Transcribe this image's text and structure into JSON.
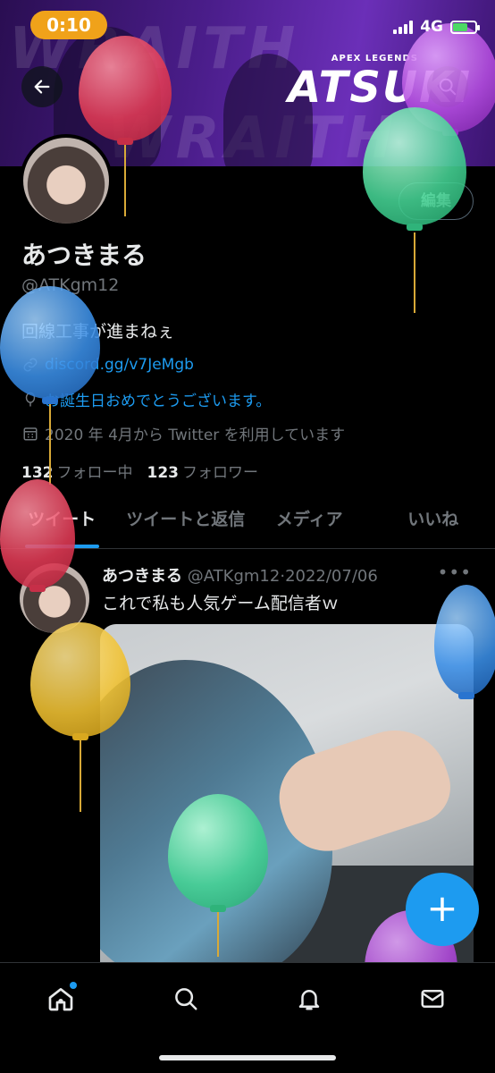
{
  "status_bar": {
    "time": "0:10",
    "network": "4G"
  },
  "banner": {
    "subtitle": "APEX LEGENDS",
    "name": "ATSUKI",
    "stripe_text": "WRAITH"
  },
  "profile": {
    "edit_label": "編集",
    "display_name": "あつきまる",
    "handle": "@ATKgm12",
    "bio": "回線工事が進まねぇ",
    "link": "discord.gg/v7JeMgb",
    "birthday": "お誕生日おめでとうございます。",
    "joined": "2020 年 4月から Twitter を利用しています",
    "following_count": "132",
    "following_label": "フォロー中",
    "followers_count": "123",
    "followers_label": "フォロワー"
  },
  "tabs": [
    {
      "label": "ツイート"
    },
    {
      "label": "ツイートと返信"
    },
    {
      "label": "メディア"
    },
    {
      "label": "いいね"
    }
  ],
  "tweet": {
    "name": "あつきまる",
    "handle": "@ATKgm12",
    "separator": "·",
    "date": "2022/07/06",
    "text": "これで私も人気ゲーム配信者ｗ",
    "more": "•••"
  },
  "fab": {
    "label": "+"
  },
  "nav": [
    {
      "icon": "home-icon"
    },
    {
      "icon": "search-icon"
    },
    {
      "icon": "notifications-icon"
    },
    {
      "icon": "messages-icon"
    }
  ],
  "colors": {
    "accent": "#1d9bf0",
    "background": "#000000",
    "muted": "#71767b"
  }
}
